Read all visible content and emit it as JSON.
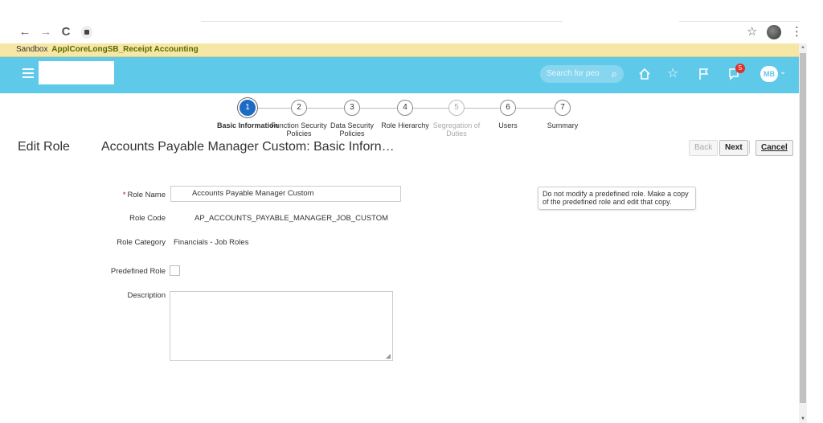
{
  "browser": {
    "back": "←",
    "forward": "→",
    "reload": "C",
    "star": "☆",
    "menu": "⋮"
  },
  "sandbox": {
    "label": "Sandbox",
    "name": "ApplCoreLongSB_Receipt Accounting"
  },
  "header": {
    "search_placeholder": "Search for peo",
    "notification_count": "5",
    "avatar_initials": "MB",
    "icons": [
      "hamburger-icon",
      "search-icon",
      "home-icon",
      "star-icon",
      "flag-icon",
      "notifications-icon"
    ]
  },
  "train": {
    "steps": [
      {
        "num": "1",
        "label": "Basic Information",
        "state": "active"
      },
      {
        "num": "2",
        "label": "Function Security Policies",
        "state": "normal"
      },
      {
        "num": "3",
        "label": "Data Security Policies",
        "state": "normal"
      },
      {
        "num": "4",
        "label": "Role Hierarchy",
        "state": "normal"
      },
      {
        "num": "5",
        "label": "Segregation of Duties",
        "state": "disabled"
      },
      {
        "num": "6",
        "label": "Users",
        "state": "normal"
      },
      {
        "num": "7",
        "label": "Summary",
        "state": "normal"
      }
    ]
  },
  "page": {
    "section": "Edit Role",
    "title": "Accounts Payable Manager Custom: Basic Inforn…",
    "back_label": "Back",
    "next_label": "Next",
    "cancel_label": "Cancel"
  },
  "form": {
    "required_mark": "*",
    "role_name_label": "Role Name",
    "role_name_value": "Accounts Payable Manager Custom",
    "role_code_label": "Role Code",
    "role_code_value": "AP_ACCOUNTS_PAYABLE_MANAGER_JOB_CUSTOM",
    "role_category_label": "Role Category",
    "role_category_value": "Financials - Job Roles",
    "predefined_label": "Predefined Role",
    "description_label": "Description",
    "description_value": ""
  },
  "note": {
    "text": "Do not modify a predefined role. Make a copy of the predefined role and edit that copy."
  }
}
